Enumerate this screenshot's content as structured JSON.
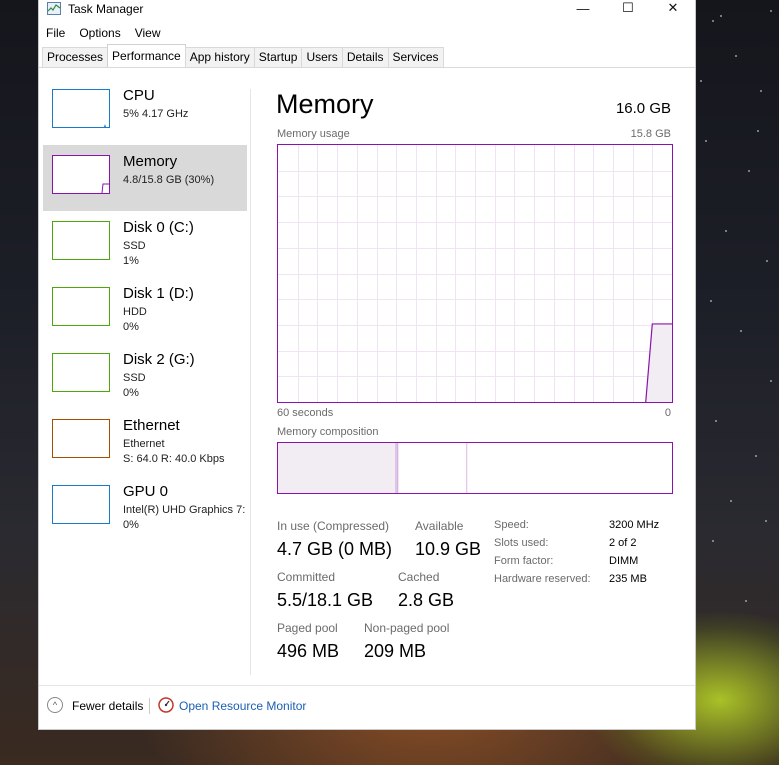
{
  "window": {
    "title": "Task Manager",
    "controls": {
      "minimize": "—",
      "maximize": "☐",
      "close": "✕"
    }
  },
  "menu": [
    "File",
    "Options",
    "View"
  ],
  "tabs": [
    {
      "label": "Processes",
      "active": false
    },
    {
      "label": "Performance",
      "active": true
    },
    {
      "label": "App history",
      "active": false
    },
    {
      "label": "Startup",
      "active": false
    },
    {
      "label": "Users",
      "active": false
    },
    {
      "label": "Details",
      "active": false
    },
    {
      "label": "Services",
      "active": false
    }
  ],
  "sidebar": {
    "items": [
      {
        "title": "CPU",
        "line1": "5% 4.17 GHz",
        "line2": "",
        "color": "#1979ca",
        "selected": false
      },
      {
        "title": "Memory",
        "line1": "4.8/15.8 GB (30%)",
        "line2": "",
        "color": "#8b12ae",
        "selected": true
      },
      {
        "title": "Disk 0 (C:)",
        "line1": "SSD",
        "line2": "1%",
        "color": "#4da60c",
        "selected": false
      },
      {
        "title": "Disk 1 (D:)",
        "line1": "HDD",
        "line2": "0%",
        "color": "#4da60c",
        "selected": false
      },
      {
        "title": "Disk 2 (G:)",
        "line1": "SSD",
        "line2": "0%",
        "color": "#4da60c",
        "selected": false
      },
      {
        "title": "Ethernet",
        "line1": "Ethernet",
        "line2": "S: 64.0  R: 40.0 Kbps",
        "color": "#a74f01",
        "selected": false
      },
      {
        "title": "GPU 0",
        "line1": "Intel(R) UHD Graphics 7:",
        "line2": "0%",
        "color": "#1979ca",
        "selected": false
      }
    ]
  },
  "main": {
    "title": "Memory",
    "total": "16.0 GB",
    "usage_label": "Memory usage",
    "usage_max": "15.8 GB",
    "time_left": "60 seconds",
    "time_right": "0",
    "composition_label": "Memory composition",
    "accent": "#8b12ae"
  },
  "stats": {
    "in_use_label": "In use (Compressed)",
    "in_use_value": "4.7 GB (0 MB)",
    "available_label": "Available",
    "available_value": "10.9 GB",
    "committed_label": "Committed",
    "committed_value": "5.5/18.1 GB",
    "cached_label": "Cached",
    "cached_value": "2.8 GB",
    "paged_label": "Paged pool",
    "paged_value": "496 MB",
    "nonpaged_label": "Non-paged pool",
    "nonpaged_value": "209 MB"
  },
  "specs": [
    {
      "label": "Speed:",
      "value": "3200 MHz"
    },
    {
      "label": "Slots used:",
      "value": "2 of 2"
    },
    {
      "label": "Form factor:",
      "value": "DIMM"
    },
    {
      "label": "Hardware reserved:",
      "value": "235 MB"
    }
  ],
  "footer": {
    "fewer_details": "Fewer details",
    "resource_monitor": "Open Resource Monitor"
  },
  "chart_data": {
    "type": "area",
    "title": "",
    "xlabel": "",
    "ylabel": "",
    "x_range_seconds": [
      60,
      0
    ],
    "ylim": [
      0,
      15.8
    ],
    "series": [
      {
        "values_gb": [
          0,
          0,
          0,
          0,
          0,
          0,
          0,
          0,
          0,
          0,
          0,
          0,
          0,
          0,
          0,
          0,
          0,
          0,
          0,
          0,
          0,
          0,
          0,
          0,
          0,
          0,
          0,
          0,
          0,
          0,
          0,
          0,
          0,
          0,
          0,
          0,
          0,
          0,
          0,
          0,
          0,
          0,
          0,
          0,
          0,
          0,
          0,
          0,
          0,
          0,
          0,
          0,
          0,
          0,
          0,
          0,
          0,
          4.8,
          4.8,
          4.8,
          4.8
        ]
      }
    ],
    "composition": {
      "in_use_fraction": 0.3,
      "modified_fraction": 0.005,
      "standby_fraction": 0.175,
      "free_fraction": 0.52
    },
    "grid": true
  }
}
